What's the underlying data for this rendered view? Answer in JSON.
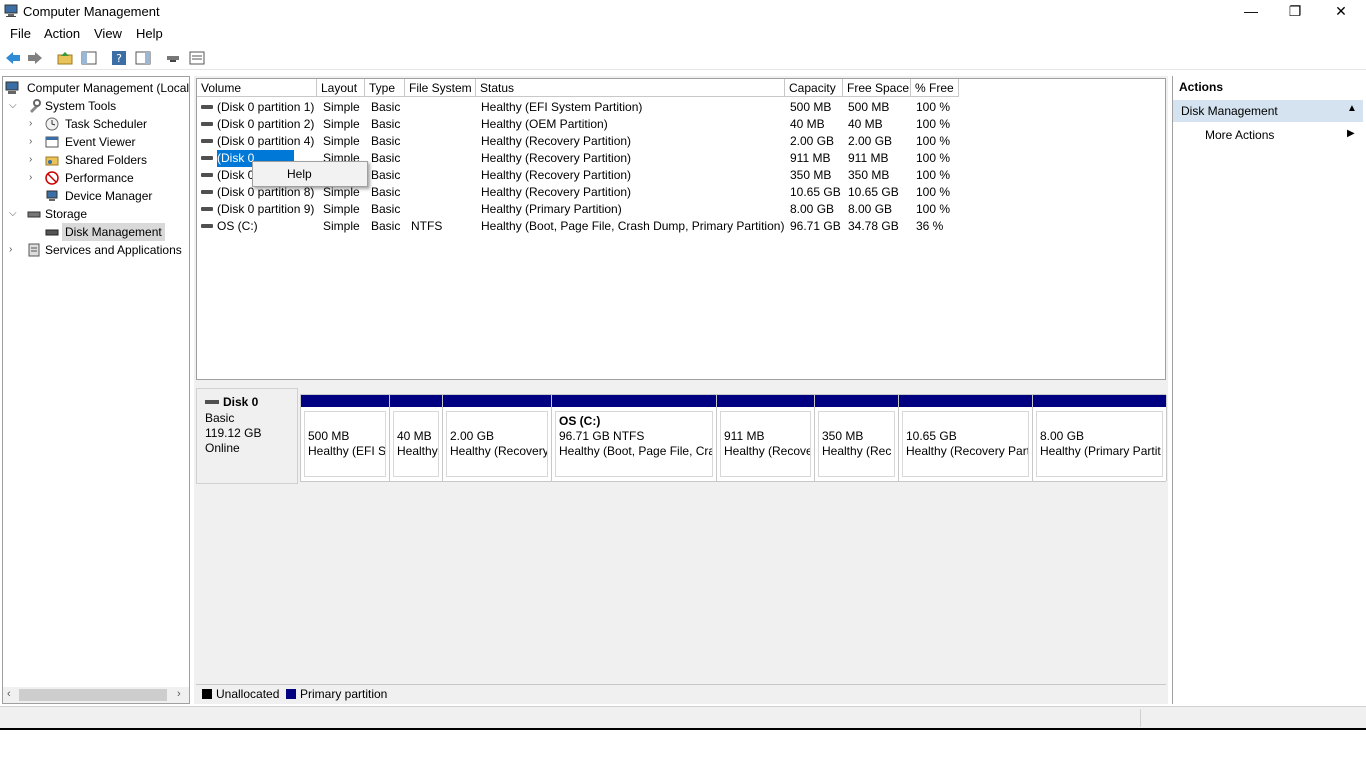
{
  "window": {
    "title": "Computer Management",
    "min_glyph": "—",
    "max_glyph": "❐",
    "close_glyph": "✕"
  },
  "menu": [
    "File",
    "Action",
    "View",
    "Help"
  ],
  "tree": {
    "root": "Computer Management (Local",
    "system_tools": "System Tools",
    "task_scheduler": "Task Scheduler",
    "event_viewer": "Event Viewer",
    "shared_folders": "Shared Folders",
    "performance": "Performance",
    "device_manager": "Device Manager",
    "storage": "Storage",
    "disk_management": "Disk Management",
    "services_apps": "Services and Applications"
  },
  "volume_table": {
    "columns": [
      "Volume",
      "Layout",
      "Type",
      "File System",
      "Status",
      "Capacity",
      "Free Space",
      "% Free"
    ],
    "rows": [
      [
        "(Disk 0 partition 1)",
        "Simple",
        "Basic",
        "",
        "Healthy (EFI System Partition)",
        "500 MB",
        "500 MB",
        "100 %"
      ],
      [
        "(Disk 0 partition 2)",
        "Simple",
        "Basic",
        "",
        "Healthy (OEM Partition)",
        "40 MB",
        "40 MB",
        "100 %"
      ],
      [
        "(Disk 0 partition 4)",
        "Simple",
        "Basic",
        "",
        "Healthy (Recovery Partition)",
        "2.00 GB",
        "2.00 GB",
        "100 %"
      ],
      [
        "(Disk 0",
        "Simple",
        "Basic",
        "",
        "Healthy (Recovery Partition)",
        "911 MB",
        "911 MB",
        "100 %"
      ],
      [
        "(Disk 0",
        "Simple",
        "Basic",
        "",
        "Healthy (Recovery Partition)",
        "350 MB",
        "350 MB",
        "100 %"
      ],
      [
        "(Disk 0 partition 8)",
        "Simple",
        "Basic",
        "",
        "Healthy (Recovery Partition)",
        "10.65 GB",
        "10.65 GB",
        "100 %"
      ],
      [
        "(Disk 0 partition 9)",
        "Simple",
        "Basic",
        "",
        "Healthy (Primary Partition)",
        "8.00 GB",
        "8.00 GB",
        "100 %"
      ],
      [
        "OS (C:)",
        "Simple",
        "Basic",
        "NTFS",
        "Healthy (Boot, Page File, Crash Dump, Primary Partition)",
        "96.71 GB",
        "34.78 GB",
        "36 %"
      ]
    ]
  },
  "context_menu": {
    "help": "Help"
  },
  "disk": {
    "name": "Disk 0",
    "type": "Basic",
    "size": "119.12 GB",
    "state": "Online",
    "partitions": [
      {
        "title": "",
        "size": "500 MB",
        "status": "Healthy (EFI S"
      },
      {
        "title": "",
        "size": "40 MB",
        "status": "Healthy"
      },
      {
        "title": "",
        "size": "2.00 GB",
        "status": "Healthy (Recovery"
      },
      {
        "title": "OS  (C:)",
        "size": "96.71 GB NTFS",
        "status": "Healthy (Boot, Page File, Cra"
      },
      {
        "title": "",
        "size": "911 MB",
        "status": "Healthy (Recove"
      },
      {
        "title": "",
        "size": "350 MB",
        "status": "Healthy (Rec"
      },
      {
        "title": "",
        "size": "10.65 GB",
        "status": "Healthy (Recovery Part"
      },
      {
        "title": "",
        "size": "8.00 GB",
        "status": "Healthy (Primary Partit"
      }
    ]
  },
  "legend": {
    "unallocated": "Unallocated",
    "primary": "Primary partition",
    "unallocated_color": "#000000",
    "primary_color": "#000080"
  },
  "actions": {
    "title": "Actions",
    "section": "Disk Management",
    "more": "More Actions"
  }
}
